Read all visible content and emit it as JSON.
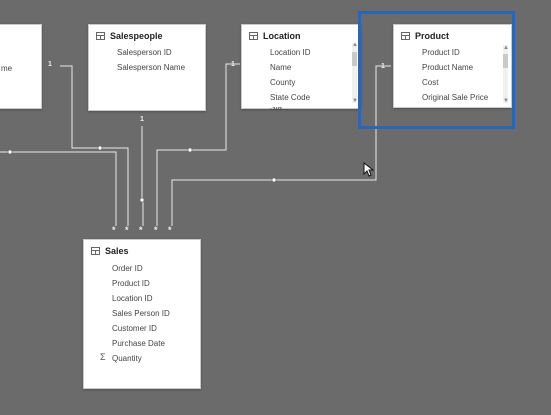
{
  "tables": {
    "partial_left": {
      "visible_field": "me"
    },
    "salespeople": {
      "title": "Salespeople",
      "fields": [
        "Salesperson ID",
        "Salesperson Name"
      ]
    },
    "location": {
      "title": "Location",
      "fields": [
        "Location ID",
        "Name",
        "County",
        "State Code",
        "Sta..."
      ]
    },
    "product": {
      "title": "Product",
      "fields": [
        "Product ID",
        "Product Name",
        "Cost",
        "Original Sale Price"
      ],
      "selected": true
    },
    "sales": {
      "title": "Sales",
      "fields": [
        "Order ID",
        "Product ID",
        "Location ID",
        "Sales Person ID",
        "Customer ID",
        "Purchase Date"
      ],
      "measure_fields": [
        "Quantity"
      ],
      "measure_symbol": "Σ"
    }
  },
  "relationships": {
    "one_label": "1",
    "many_label": "*"
  },
  "colors": {
    "canvas": "#6b6b6b",
    "selection": "#2b66b4",
    "line": "#e8e8e8"
  },
  "icons": [
    "table-icon",
    "scroll-up-arrow-icon",
    "scroll-down-arrow-icon",
    "sigma-icon",
    "mouse-cursor-icon"
  ]
}
